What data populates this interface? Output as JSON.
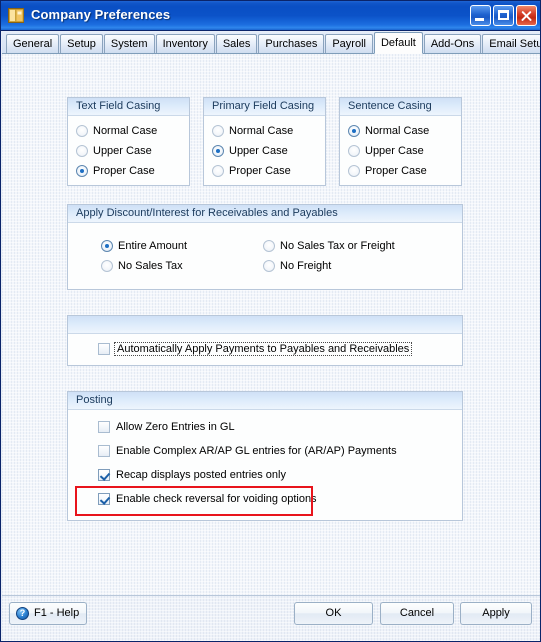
{
  "window": {
    "title": "Company Preferences",
    "icon": "company-folder-icon",
    "controls": {
      "minimize": "Minimize",
      "maximize": "Maximize",
      "close": "Close"
    }
  },
  "tabs": [
    {
      "label": "General",
      "active": false
    },
    {
      "label": "Setup",
      "active": false
    },
    {
      "label": "System",
      "active": false
    },
    {
      "label": "Inventory",
      "active": false
    },
    {
      "label": "Sales",
      "active": false
    },
    {
      "label": "Purchases",
      "active": false
    },
    {
      "label": "Payroll",
      "active": false
    },
    {
      "label": "Default",
      "active": true
    },
    {
      "label": "Add-Ons",
      "active": false
    },
    {
      "label": "Email Setup",
      "active": false
    }
  ],
  "groups": {
    "text_field_casing": {
      "title": "Text Field Casing",
      "options": [
        {
          "label": "Normal Case",
          "selected": false
        },
        {
          "label": "Upper Case",
          "selected": false
        },
        {
          "label": "Proper Case",
          "selected": true
        }
      ]
    },
    "primary_field_casing": {
      "title": "Primary Field Casing",
      "options": [
        {
          "label": "Normal Case",
          "selected": false
        },
        {
          "label": "Upper Case",
          "selected": true
        },
        {
          "label": "Proper Case",
          "selected": false
        }
      ]
    },
    "sentence_casing": {
      "title": "Sentence Casing",
      "options": [
        {
          "label": "Normal Case",
          "selected": true
        },
        {
          "label": "Upper Case",
          "selected": false
        },
        {
          "label": "Proper Case",
          "selected": false
        }
      ]
    },
    "discount": {
      "title": "Apply Discount/Interest for Receivables and Payables",
      "options": [
        {
          "label": "Entire Amount",
          "selected": true
        },
        {
          "label": "No Sales Tax",
          "selected": false
        },
        {
          "label": "No Sales Tax or Freight",
          "selected": false
        },
        {
          "label": "No Freight",
          "selected": false
        }
      ]
    },
    "auto_apply": {
      "title": "",
      "checkboxes": [
        {
          "label": "Automatically Apply Payments to Payables and Receivables",
          "checked": false,
          "focused": true
        }
      ]
    },
    "posting": {
      "title": "Posting",
      "checkboxes": [
        {
          "label": "Allow Zero Entries in GL",
          "checked": false,
          "highlighted": false
        },
        {
          "label": "Enable Complex AR/AP  GL entries for (AR/AP)  Payments",
          "checked": false,
          "highlighted": false
        },
        {
          "label": "Recap displays posted entries only",
          "checked": true,
          "highlighted": false
        },
        {
          "label": "Enable check reversal for voiding options",
          "checked": true,
          "highlighted": true
        }
      ]
    }
  },
  "footer": {
    "help": "F1 - Help",
    "help_icon": "question-mark-icon",
    "ok": "OK",
    "cancel": "Cancel",
    "apply": "Apply"
  },
  "colors": {
    "titlebar_blue": "#0b52c8",
    "accent_blue": "#1d6fc4",
    "highlight_red": "#e8141c",
    "group_header_blue": "#cfe0f6"
  }
}
